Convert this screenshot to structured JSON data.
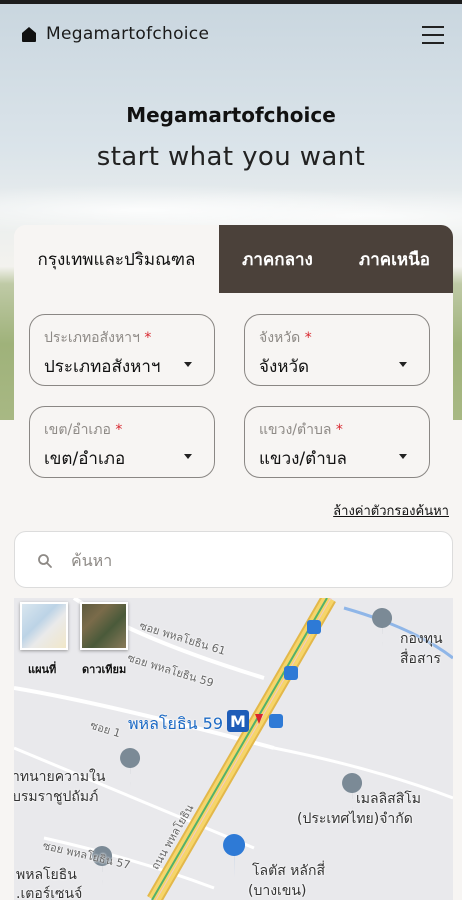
{
  "header": {
    "brand": "Megamartofchoice",
    "title": "Megamartofchoice",
    "subtitle": "start what you want"
  },
  "tabs": [
    {
      "label": "กรุงเทพและปริมณฑล",
      "active": true
    },
    {
      "label": "ภาคกลาง",
      "active": false
    },
    {
      "label": "ภาคเหนือ",
      "active": false
    }
  ],
  "filters": {
    "property_type": {
      "label": "ประเภทอสังหาฯ",
      "value": "ประเภทอสังหาฯ",
      "required_mark": "*"
    },
    "province": {
      "label": "จังหวัด",
      "value": "จังหวัด",
      "required_mark": "*"
    },
    "district": {
      "label": "เขต/อำเภอ",
      "value": "เขต/อำเภอ",
      "required_mark": "*"
    },
    "subdistrict": {
      "label": "แขวง/ตำบล",
      "value": "แขวง/ตำบล",
      "required_mark": "*"
    },
    "clear_label": "ล้างค่าตัวกรองค้นหา"
  },
  "search": {
    "placeholder": "ค้นหา",
    "value": ""
  },
  "map": {
    "layer_map_label": "แผนที่",
    "layer_satellite_label": "ดาวเทียม",
    "labels": {
      "soi61": "ซอย พหลโยธิน 61",
      "soi59": "ซอย พหลโยธิน 59",
      "soi1": "ซอย 1",
      "station": "พหลโยธิน 59",
      "poi_fund_1": "กองทุน",
      "poi_fund_2": "สื่อสาร",
      "poi_law_1": "าทนายความใน",
      "poi_law_2": "บรมราชูปถัมภ์",
      "poi_mellis_1": "เมลลิสสิโม",
      "poi_mellis_2": "(ประเทศไทย)จำกัด",
      "soi57": "ซอย พหลโยธิน 57",
      "road": "ถนน พหลโยธิน",
      "lotus_1": "โลตัส หลักสี่",
      "lotus_2": "(บางเขน)",
      "center_1": "พหลโยธิน",
      "center_2": ".เตอร์เซนจ์"
    }
  },
  "colors": {
    "tab_dark": "#4b413a",
    "required": "#d8262e",
    "map_blue": "#1b69c4",
    "road_yellow": "#f6d56a"
  }
}
